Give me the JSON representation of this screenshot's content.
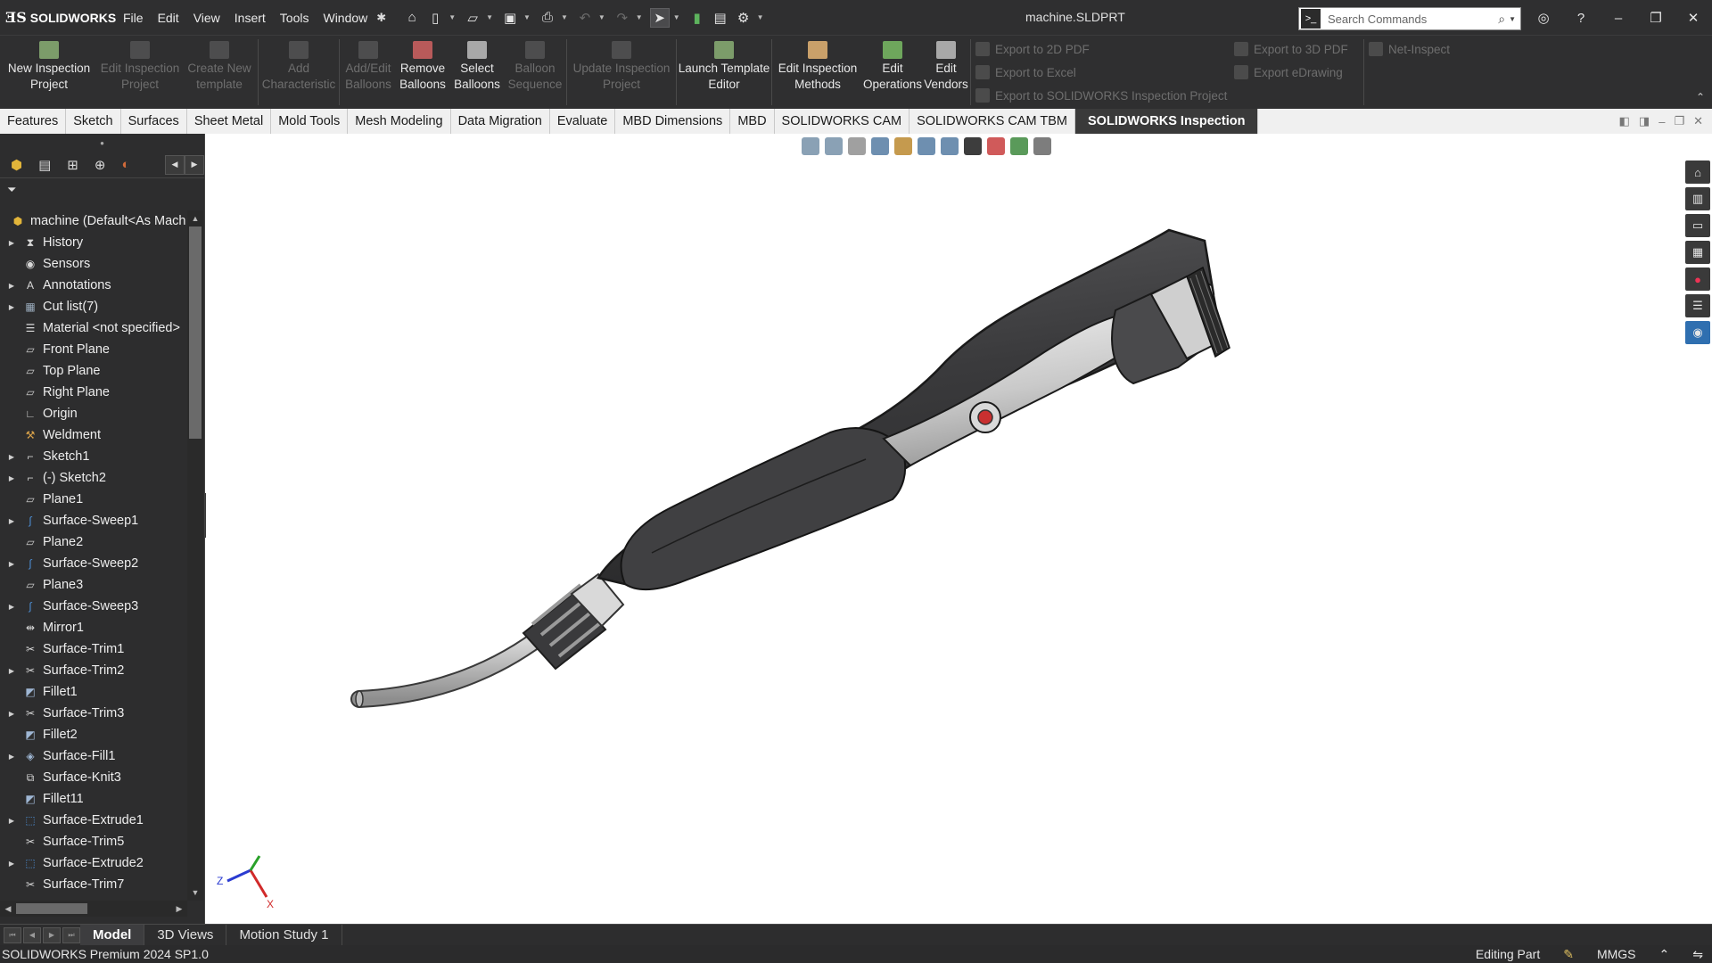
{
  "app": {
    "brand": "SOLIDWORKS",
    "document_title": "machine.SLDPRT"
  },
  "menu": [
    "File",
    "Edit",
    "View",
    "Insert",
    "Tools",
    "Window"
  ],
  "search": {
    "placeholder": "Search Commands"
  },
  "ribbon": {
    "buttons": [
      {
        "label": "New Inspection Project",
        "enabled": true
      },
      {
        "label": "Edit Inspection Project",
        "enabled": false
      },
      {
        "label": "Create New template",
        "enabled": false
      },
      {
        "label": "Add Characteristic",
        "enabled": false
      },
      {
        "label": "Add/Edit Balloons",
        "enabled": false
      },
      {
        "label": "Remove Balloons",
        "enabled": true
      },
      {
        "label": "Select Balloons",
        "enabled": true
      },
      {
        "label": "Balloon Sequence",
        "enabled": false
      },
      {
        "label": "Update Inspection Project",
        "enabled": false
      },
      {
        "label": "Launch Template Editor",
        "enabled": true
      },
      {
        "label": "Edit Inspection Methods",
        "enabled": true
      },
      {
        "label": "Edit Operations",
        "enabled": true
      },
      {
        "label": "Edit Vendors",
        "enabled": true
      }
    ],
    "exports_col1": [
      "Export to 2D PDF",
      "Export to Excel",
      "Export to SOLIDWORKS Inspection Project"
    ],
    "exports_col2": [
      "Export to 3D PDF",
      "Export eDrawing"
    ],
    "net_inspect": "Net-Inspect"
  },
  "tabs": [
    {
      "label": "Features",
      "active": false
    },
    {
      "label": "Sketch",
      "active": false
    },
    {
      "label": "Surfaces",
      "active": false
    },
    {
      "label": "Sheet Metal",
      "active": false
    },
    {
      "label": "Mold Tools",
      "active": false
    },
    {
      "label": "Mesh Modeling",
      "active": false
    },
    {
      "label": "Data Migration",
      "active": false
    },
    {
      "label": "Evaluate",
      "active": false
    },
    {
      "label": "MBD Dimensions",
      "active": false
    },
    {
      "label": "MBD",
      "active": false
    },
    {
      "label": "SOLIDWORKS CAM",
      "active": false
    },
    {
      "label": "SOLIDWORKS CAM TBM",
      "active": false
    },
    {
      "label": "SOLIDWORKS Inspection",
      "active": true
    }
  ],
  "feature_tree": [
    {
      "label": "machine (Default<As Mach",
      "icon": "part-icon",
      "expandable": false,
      "root": true
    },
    {
      "label": "History",
      "icon": "history-icon",
      "expandable": true
    },
    {
      "label": "Sensors",
      "icon": "sensor-icon",
      "expandable": false
    },
    {
      "label": "Annotations",
      "icon": "annotation-icon",
      "expandable": true
    },
    {
      "label": "Cut list(7)",
      "icon": "cutlist-icon",
      "expandable": true
    },
    {
      "label": "Material <not specified>",
      "icon": "material-icon",
      "expandable": false
    },
    {
      "label": "Front Plane",
      "icon": "plane-icon",
      "expandable": false
    },
    {
      "label": "Top Plane",
      "icon": "plane-icon",
      "expandable": false
    },
    {
      "label": "Right Plane",
      "icon": "plane-icon",
      "expandable": false
    },
    {
      "label": "Origin",
      "icon": "origin-icon",
      "expandable": false
    },
    {
      "label": "Weldment",
      "icon": "weldment-icon",
      "expandable": false
    },
    {
      "label": "Sketch1",
      "icon": "sketch-icon",
      "expandable": true
    },
    {
      "label": "(-) Sketch2",
      "icon": "sketch-icon",
      "expandable": true
    },
    {
      "label": "Plane1",
      "icon": "plane-icon",
      "expandable": false
    },
    {
      "label": "Surface-Sweep1",
      "icon": "sweep-icon",
      "expandable": true
    },
    {
      "label": "Plane2",
      "icon": "plane-icon",
      "expandable": false
    },
    {
      "label": "Surface-Sweep2",
      "icon": "sweep-icon",
      "expandable": true
    },
    {
      "label": "Plane3",
      "icon": "plane-icon",
      "expandable": false
    },
    {
      "label": "Surface-Sweep3",
      "icon": "sweep-icon",
      "expandable": true
    },
    {
      "label": "Mirror1",
      "icon": "mirror-icon",
      "expandable": false
    },
    {
      "label": "Surface-Trim1",
      "icon": "trim-icon",
      "expandable": false
    },
    {
      "label": "Surface-Trim2",
      "icon": "trim-icon",
      "expandable": true
    },
    {
      "label": "Fillet1",
      "icon": "fillet-icon",
      "expandable": false
    },
    {
      "label": "Surface-Trim3",
      "icon": "trim-icon",
      "expandable": true
    },
    {
      "label": "Fillet2",
      "icon": "fillet-icon",
      "expandable": false
    },
    {
      "label": "Surface-Fill1",
      "icon": "fill-icon",
      "expandable": true
    },
    {
      "label": "Surface-Knit3",
      "icon": "knit-icon",
      "expandable": false
    },
    {
      "label": "Fillet11",
      "icon": "fillet-icon",
      "expandable": false
    },
    {
      "label": "Surface-Extrude1",
      "icon": "extrude-icon",
      "expandable": true
    },
    {
      "label": "Surface-Trim5",
      "icon": "trim-icon",
      "expandable": false
    },
    {
      "label": "Surface-Extrude2",
      "icon": "extrude-icon",
      "expandable": true
    },
    {
      "label": "Surface-Trim7",
      "icon": "trim-icon",
      "expandable": false
    }
  ],
  "bottom_tabs": [
    {
      "label": "Model",
      "active": true
    },
    {
      "label": "3D Views",
      "active": false
    },
    {
      "label": "Motion Study 1",
      "active": false
    }
  ],
  "status": {
    "product": "SOLIDWORKS Premium 2024 SP1.0",
    "mode": "Editing Part",
    "units": "MMGS"
  },
  "triad": {
    "z": "Z",
    "x": "X"
  },
  "colors": {
    "chrome": "#2f2f30",
    "active_tab": "#3a3a3a",
    "body": "#3e3e40",
    "accent_red": "#d63a3a"
  }
}
